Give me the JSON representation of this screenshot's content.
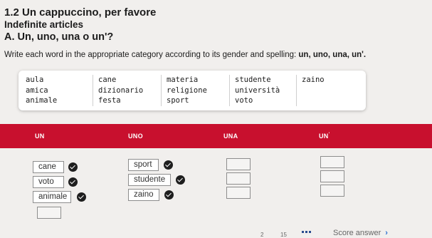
{
  "heading": {
    "lesson": "1.2 Un cappuccino, per favore",
    "topic": "Indefinite articles",
    "section": "A. Un, uno, una o un'?"
  },
  "instructions": {
    "text": "Write each word in the appropriate category according to its gender and spelling: ",
    "bold": "un, uno, una, un'."
  },
  "word_bank": {
    "columns": [
      [
        "aula",
        "amica",
        "animale"
      ],
      [
        "cane",
        "dizionario",
        "festa"
      ],
      [
        "materia",
        "religione",
        "sport"
      ],
      [
        "studente",
        "università",
        "voto"
      ],
      [
        "zaino"
      ]
    ]
  },
  "categories": [
    {
      "label": "UN"
    },
    {
      "label": "UNO"
    },
    {
      "label": "UNA"
    },
    {
      "label": "UN",
      "sup": "'"
    }
  ],
  "placed": {
    "un": [
      "cane",
      "voto",
      "animale"
    ],
    "uno": [
      "sport",
      "studente",
      "zaino"
    ]
  },
  "footer": {
    "page_fragment_1": "2",
    "page_fragment_2": "15",
    "score_label": "Score answer",
    "score_icon": "chevron-right-icon",
    "grid_icon": "grid-dots-icon"
  },
  "colors": {
    "header_bar": "#c8102e",
    "check": "#1e1e1e",
    "accent_blue": "#2a4d8f"
  }
}
